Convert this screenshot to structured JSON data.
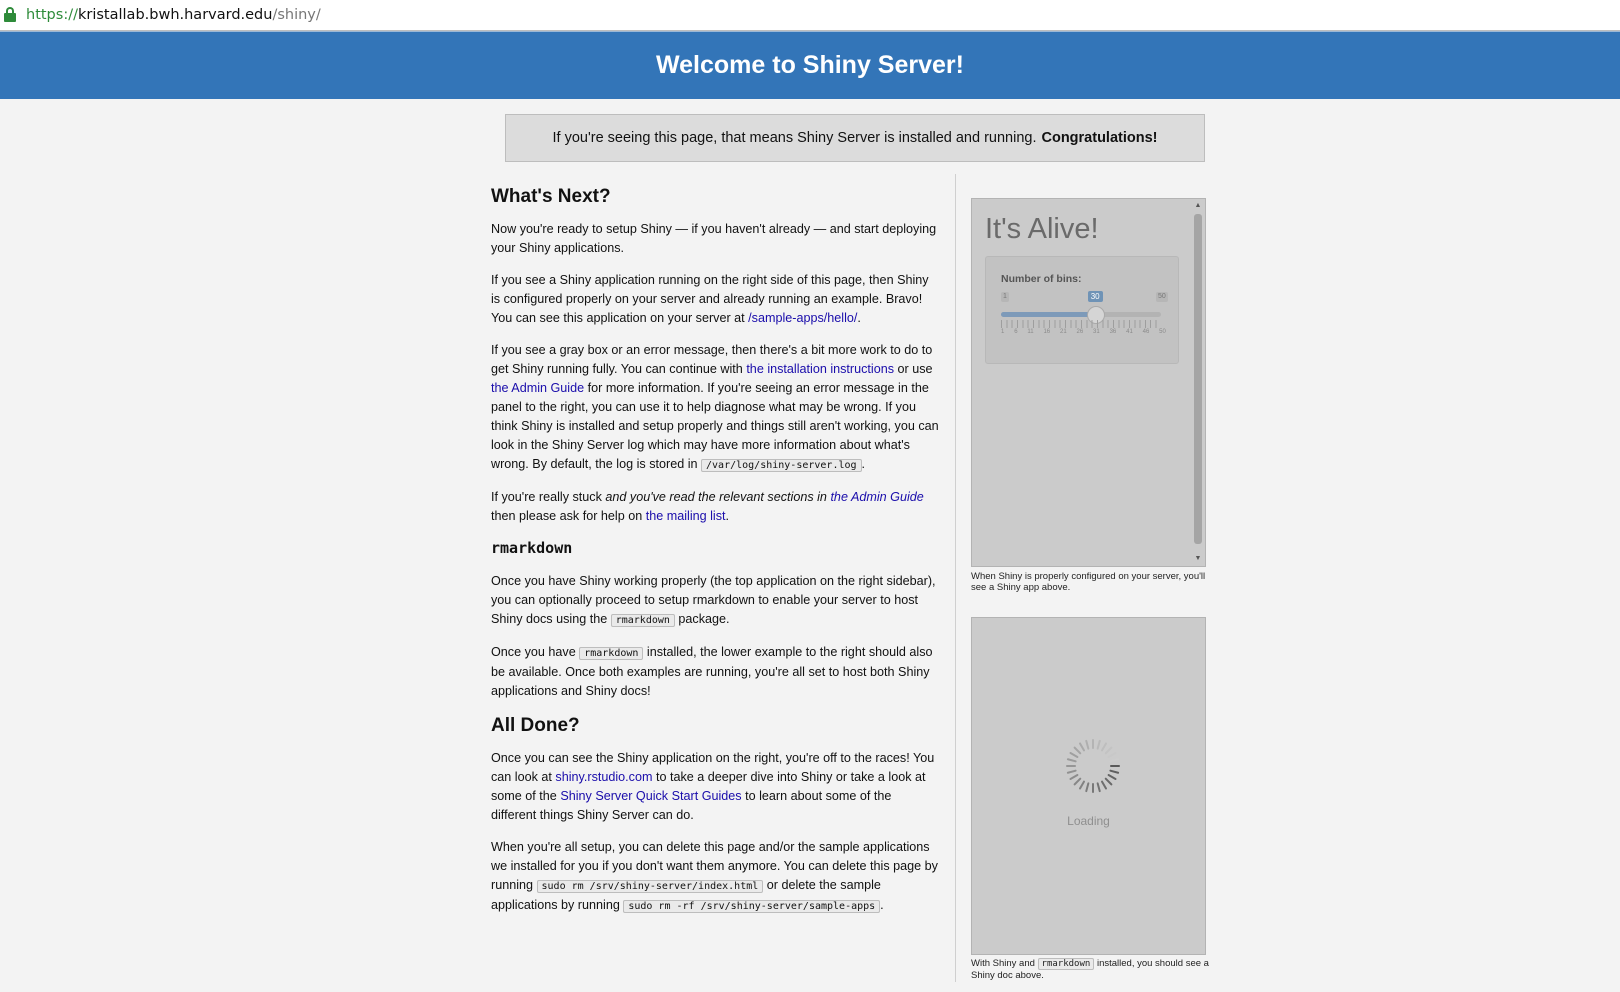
{
  "browser": {
    "url_scheme": "https://",
    "url_host": "kristallab.bwh.harvard.edu",
    "url_path": "/shiny/",
    "lock_icon": "lock-icon"
  },
  "banner": {
    "title": "Welcome to Shiny Server!",
    "color": "#3375b8"
  },
  "notice": {
    "text": "If you're seeing this page, that means Shiny Server is installed and running.",
    "emphasis": "Congratulations!"
  },
  "whats_next": {
    "heading": "What's Next?",
    "p1": "Now you're ready to setup Shiny — if you haven't already — and start deploying your Shiny applications.",
    "p2_a": "If you see a Shiny application running on the right side of this page, then Shiny is configured properly on your server and already running an example. Bravo! You can see this application on your server at ",
    "p2_link": "/sample-apps/hello/",
    "p2_b": ".",
    "p3_a": "If you see a gray box or an error message, then there's a bit more work to do to get Shiny running fully. You can continue with ",
    "p3_link1": "the installation instructions",
    "p3_b": " or use ",
    "p3_link2": "the Admin Guide",
    "p3_c": " for more information. If you're seeing an error message in the panel to the right, you can use it to help diagnose what may be wrong. If you think Shiny is installed and setup properly and things still aren't working, you can look in the Shiny Server log which may have more information about what's wrong. By default, the log is stored in ",
    "p3_code": "/var/log/shiny-server.log",
    "p3_d": ".",
    "p4_a": "If you're really stuck ",
    "p4_em": "and you've read the relevant sections in ",
    "p4_link1": "the Admin Guide",
    "p4_b": " then please ask for help on ",
    "p4_link2": "the mailing list",
    "p4_c": "."
  },
  "rmarkdown": {
    "heading": "rmarkdown",
    "p1_a": "Once you have Shiny working properly (the top application on the right sidebar), you can optionally proceed to setup rmarkdown to enable your server to host Shiny docs using the ",
    "p1_code": "rmarkdown",
    "p1_b": " package.",
    "p2_a": "Once you have ",
    "p2_code": "rmarkdown",
    "p2_b": " installed, the lower example to the right should also be available. Once both examples are running, you're all set to host both Shiny applications and Shiny docs!"
  },
  "all_done": {
    "heading": "All Done?",
    "p1_a": "Once you can see the Shiny application on the right, you're off to the races! You can look at ",
    "p1_link1": "shiny.rstudio.com",
    "p1_b": " to take a deeper dive into Shiny or take a look at some of the ",
    "p1_link2": "Shiny Server Quick Start Guides",
    "p1_c": " to learn about some of the different things Shiny Server can do.",
    "p2_a": "When you're all setup, you can delete this page and/or the sample applications we installed for you if you don't want them anymore. You can delete this page by running ",
    "p2_code1": "sudo rm /srv/shiny-server/index.html",
    "p2_b": " or delete the sample applications by running ",
    "p2_code2": "sudo rm -rf /srv/shiny-server/sample-apps",
    "p2_c": "."
  },
  "app_panel": {
    "title": "It's Alive!",
    "slider_label": "Number of bins:",
    "slider_min": "1",
    "slider_max": "50",
    "slider_value": "30",
    "slider_value_num": 30,
    "slider_min_num": 1,
    "slider_max_num": 50,
    "tick_labels": [
      "1",
      "6",
      "11",
      "16",
      "21",
      "26",
      "31",
      "36",
      "41",
      "46",
      "50"
    ],
    "caption": "When Shiny is properly configured on your server, you'll see a Shiny app above."
  },
  "doc_panel": {
    "loading": "Loading",
    "spinner_icon": "spinner-icon",
    "caption_a": "With Shiny and ",
    "caption_code": "rmarkdown",
    "caption_b": " installed, you should see a Shiny doc above."
  }
}
